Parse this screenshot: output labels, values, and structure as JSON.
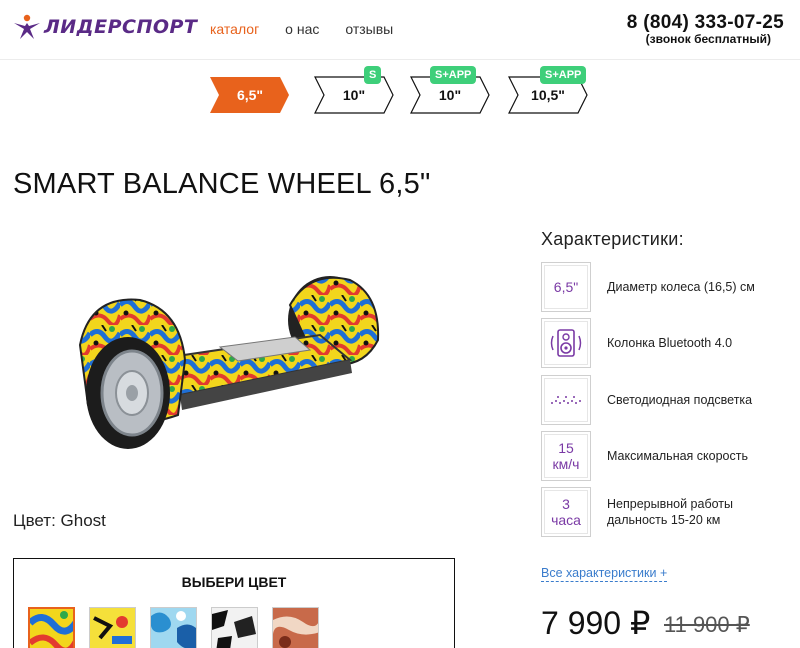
{
  "header": {
    "logo_text": "ЛИДЕРСПОРТ",
    "nav": [
      {
        "label": "каталог"
      },
      {
        "label": "о нас"
      },
      {
        "label": "отзывы"
      }
    ],
    "phone": "8 (804) 333-07-25",
    "phone_note": "(звонок бесплатный)"
  },
  "sizes": [
    {
      "label": "6,5\"",
      "badge": ""
    },
    {
      "label": "10\"",
      "badge": "S"
    },
    {
      "label": "10\"",
      "badge": "S+APP"
    },
    {
      "label": "10,5\"",
      "badge": "S+APP"
    }
  ],
  "title": "SMART BALANCE WHEEL 6,5\"",
  "color_label": "Цвет: Ghost",
  "color_box": {
    "title": "ВЫБЕРИ ЦВЕТ"
  },
  "specs": {
    "title": "Характеристики:",
    "items": [
      {
        "box": "6,5\"",
        "text": "Диаметр колеса (16,5) см"
      },
      {
        "box": "",
        "icon": "speaker-icon",
        "text": "Колонка Bluetooth 4.0"
      },
      {
        "box": "",
        "icon": "led-dots-icon",
        "text": "Светодиодная подсветка"
      },
      {
        "box": "15 км/ч",
        "text": "Максимальная скорость"
      },
      {
        "box": "3 часа",
        "text": "Непрерывной работы дальность 15-20 км"
      }
    ],
    "all_link": "Все характеристики +"
  },
  "price": {
    "current": "7 990 ₽",
    "old": "11 900 ₽"
  },
  "colors": {
    "accent": "#e8621c",
    "brand": "#5a2a86",
    "spec_purple": "#7a3aa5",
    "badge_green": "#3ecf7a",
    "link_blue": "#3a7ccc"
  }
}
